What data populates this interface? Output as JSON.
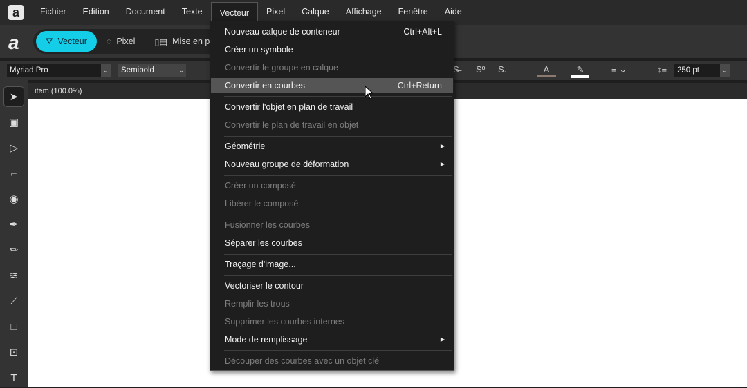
{
  "menubar": {
    "items": [
      "Fichier",
      "Edition",
      "Document",
      "Texte",
      "Vecteur",
      "Pixel",
      "Calque",
      "Affichage",
      "Fenêtre",
      "Aide"
    ],
    "active": "Vecteur"
  },
  "personas": [
    {
      "label": "Vecteur"
    },
    {
      "label": "Pixel"
    },
    {
      "label": "Mise en page"
    }
  ],
  "context": {
    "font": "Myriad Pro",
    "weight": "Semibold",
    "size": "250 pt"
  },
  "document": {
    "tab": "item (100.0%)"
  },
  "colors": {
    "accent": "#14cde6"
  },
  "menu": {
    "items": [
      {
        "label": "Nouveau calque de conteneur",
        "shortcut": "Ctrl+Alt+L",
        "enabled": true
      },
      {
        "label": "Créer un symbole",
        "enabled": true
      },
      {
        "label": "Convertir le groupe en calque",
        "enabled": false
      },
      {
        "label": "Convertir en courbes",
        "shortcut": "Ctrl+Return",
        "enabled": true,
        "hover": true
      },
      {
        "label": "Convertir l'objet en plan de travail",
        "enabled": true
      },
      {
        "label": "Convertir le plan de travail en objet",
        "enabled": false
      },
      {
        "label": "Géométrie",
        "enabled": true,
        "submenu": true
      },
      {
        "label": "Nouveau groupe de déformation",
        "enabled": true,
        "submenu": true
      },
      {
        "label": "Créer un composé",
        "enabled": false
      },
      {
        "label": "Libérer le composé",
        "enabled": false
      },
      {
        "label": "Fusionner les courbes",
        "enabled": false
      },
      {
        "label": "Séparer les courbes",
        "enabled": true
      },
      {
        "label": "Traçage d'image...",
        "enabled": true
      },
      {
        "label": "Vectoriser le contour",
        "enabled": true
      },
      {
        "label": "Remplir les trous",
        "enabled": false
      },
      {
        "label": "Supprimer les courbes internes",
        "enabled": false
      },
      {
        "label": "Mode de remplissage",
        "enabled": true,
        "submenu": true
      },
      {
        "label": "Découper des courbes avec un objet clé",
        "enabled": false
      }
    ]
  }
}
